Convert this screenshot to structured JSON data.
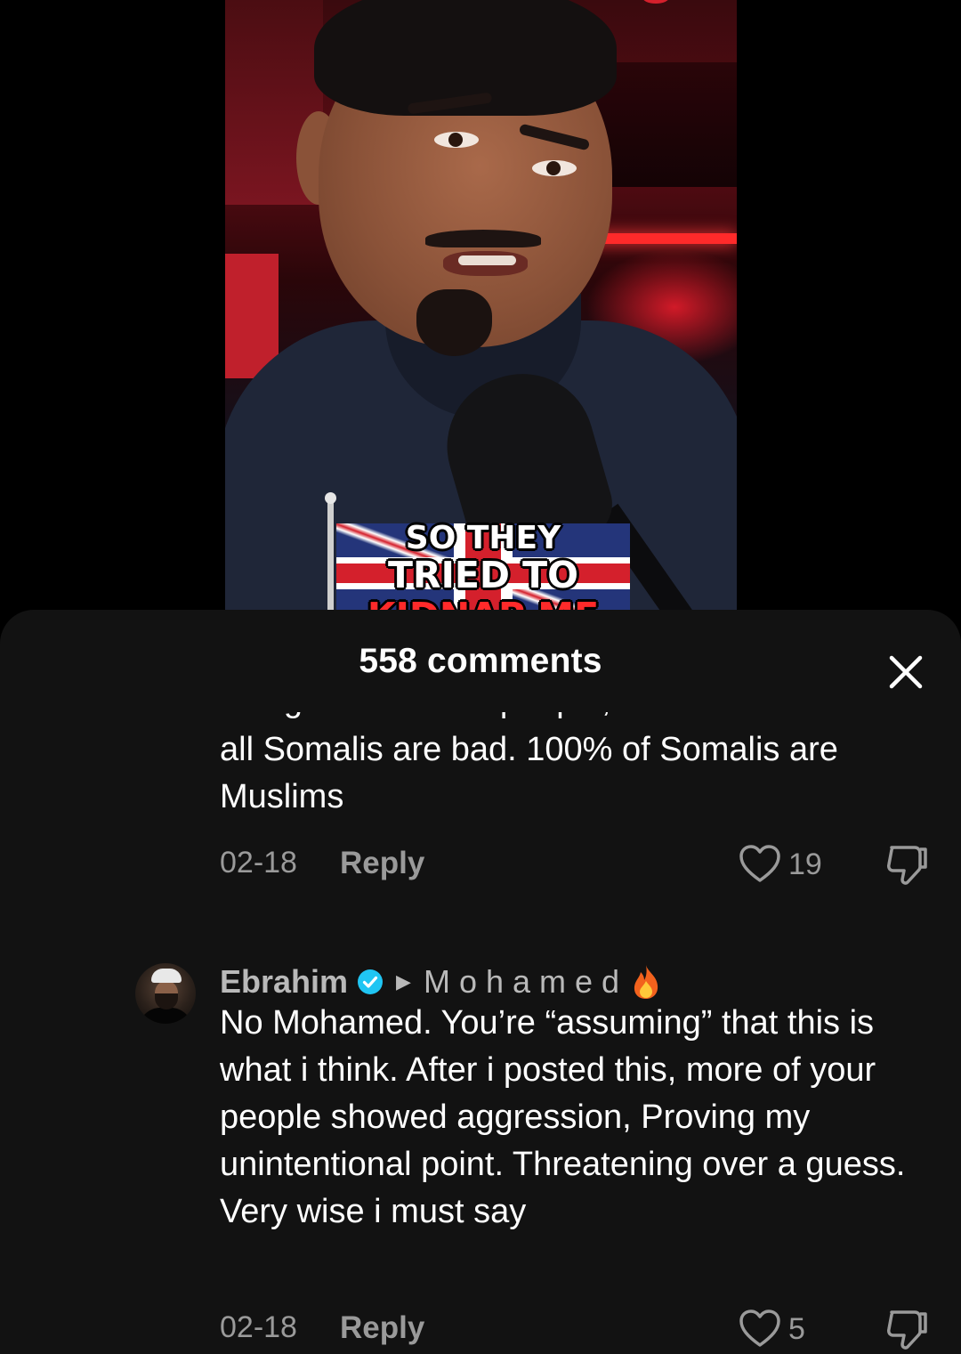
{
  "video": {
    "caption_lines": [
      "SO THEY",
      "TRIED TO",
      "KIDNAP ME"
    ]
  },
  "sheet": {
    "title": "558 comments",
    "close_icon": "close-icon"
  },
  "comments": [
    {
      "body_partial_line": "has good and bad people, so don't think",
      "body": "all Somalis are bad. 100% of Somalis are Muslims",
      "date": "02-18",
      "reply_label": "Reply",
      "likes": "19"
    },
    {
      "author": "Ebrahim",
      "verified": true,
      "reply_to": "Mohamed",
      "reply_to_emoji": "fire-icon",
      "body": "No Mohamed. You’re “assuming” that this is what i think. After i posted this, more of your people showed aggression, Proving my unintentional point. Threatening over a guess. Very wise i must say",
      "date": "02-18",
      "reply_label": "Reply",
      "likes": "5"
    }
  ],
  "colors": {
    "sheet_bg": "#121212",
    "muted_text": "#9a9a9a",
    "verified_blue": "#20c5f3"
  }
}
